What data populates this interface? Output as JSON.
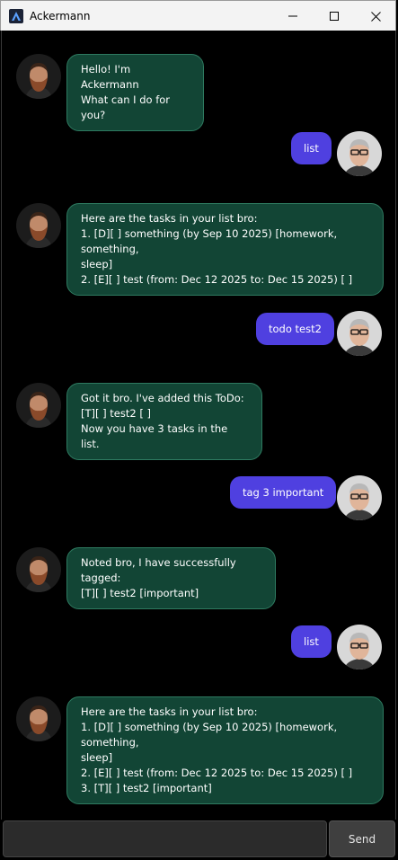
{
  "window": {
    "title": "Ackermann"
  },
  "messages": [
    {
      "sender": "bot",
      "text": "Hello! I'm Ackermann\nWhat can I do for you?"
    },
    {
      "sender": "user",
      "text": "list"
    },
    {
      "sender": "bot",
      "text": "Here are the tasks in your list bro:\n1. [D][ ] something (by Sep 10 2025) [homework, something,\nsleep]\n2. [E][ ] test (from: Dec 12 2025 to: Dec 15 2025) [ ]"
    },
    {
      "sender": "user",
      "text": "todo test2"
    },
    {
      "sender": "bot",
      "text": "Got it bro. I've added this ToDo:\n[T][ ] test2 [ ]\nNow you have 3 tasks in the list."
    },
    {
      "sender": "user",
      "text": "tag 3 important"
    },
    {
      "sender": "bot",
      "text": "Noted bro, I have successfully tagged:\n[T][ ] test2 [important]"
    },
    {
      "sender": "user",
      "text": "list"
    },
    {
      "sender": "bot",
      "text": "Here are the tasks in your list bro:\n1. [D][ ] something (by Sep 10 2025) [homework, something,\nsleep]\n2. [E][ ] test (from: Dec 12 2025 to: Dec 15 2025) [ ]\n3. [T][ ] test2 [important]"
    }
  ],
  "input": {
    "value": "",
    "placeholder": ""
  },
  "send_label": "Send",
  "colors": {
    "bot_bubble": "#124535",
    "bot_bubble_border": "#2e7a60",
    "user_bubble": "#4f40e0",
    "background": "#000000"
  }
}
